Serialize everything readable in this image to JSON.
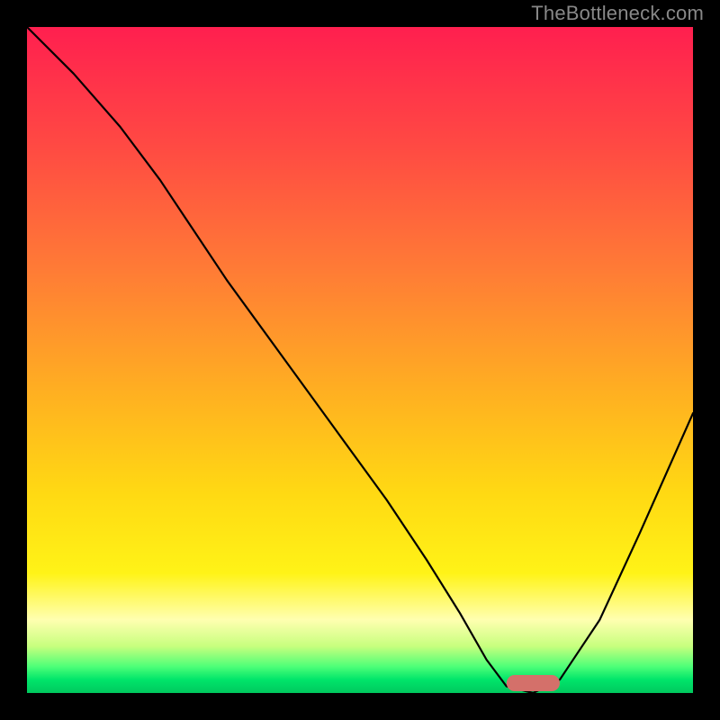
{
  "watermark": "TheBottleneck.com",
  "chart_data": {
    "type": "line",
    "title": "",
    "xlabel": "",
    "ylabel": "",
    "xlim": [
      0,
      100
    ],
    "ylim": [
      0,
      100
    ],
    "grid": false,
    "legend": false,
    "series": [
      {
        "name": "bottleneck-curve",
        "x": [
          0,
          7,
          14,
          20,
          24,
          30,
          38,
          46,
          54,
          60,
          65,
          69,
          72,
          76,
          80,
          86,
          92,
          100
        ],
        "y": [
          100,
          93,
          85,
          77,
          71,
          62,
          51,
          40,
          29,
          20,
          12,
          5,
          1,
          0,
          2,
          11,
          24,
          42
        ]
      }
    ],
    "marker": {
      "name": "optimal-range",
      "x_start": 72,
      "x_end": 80,
      "y": 0
    },
    "background_gradient": {
      "top": "#ff1f4f",
      "mid": "#ffd913",
      "bottom": "#00c85e"
    }
  }
}
